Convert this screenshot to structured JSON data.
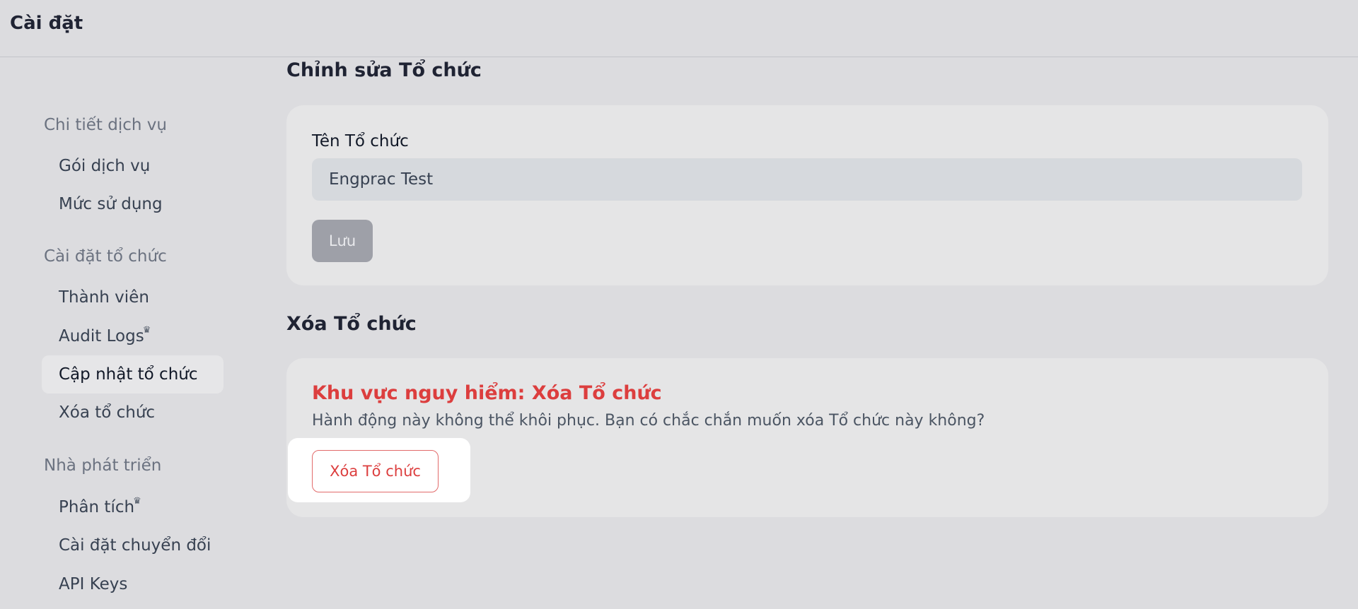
{
  "app": {
    "title": "Cài đặt"
  },
  "sidebar": {
    "groups": [
      {
        "title": "Chi tiết dịch vụ",
        "items": [
          {
            "label": "Gói dịch vụ"
          },
          {
            "label": "Mức sử dụng"
          }
        ]
      },
      {
        "title": "Cài đặt tổ chức",
        "items": [
          {
            "label": "Thành viên"
          },
          {
            "label": "Audit Logs",
            "icon": "crown-icon"
          },
          {
            "label": "Cập nhật tổ chức",
            "active": true
          },
          {
            "label": "Xóa tổ chức"
          }
        ]
      },
      {
        "title": "Nhà phát triển",
        "items": [
          {
            "label": "Phân tích",
            "icon": "crown-icon"
          },
          {
            "label": "Cài đặt chuyển đổi"
          },
          {
            "label": "API Keys"
          }
        ]
      }
    ]
  },
  "edit": {
    "heading": "Chỉnh sửa Tổ chức",
    "field_label": "Tên Tổ chức",
    "field_value": "Engprac Test",
    "save_label": "Lưu"
  },
  "delete": {
    "heading": "Xóa Tổ chức",
    "danger_title": "Khu vực nguy hiểm: Xóa Tổ chức",
    "danger_desc": "Hành động này không thể khôi phục. Bạn có chắc chắn muốn xóa Tổ chức này không?",
    "button_label": "Xóa Tổ chức"
  },
  "colors": {
    "danger": "#dc3e3e",
    "background": "#dcdcdf",
    "card": "#e5e5e6"
  }
}
